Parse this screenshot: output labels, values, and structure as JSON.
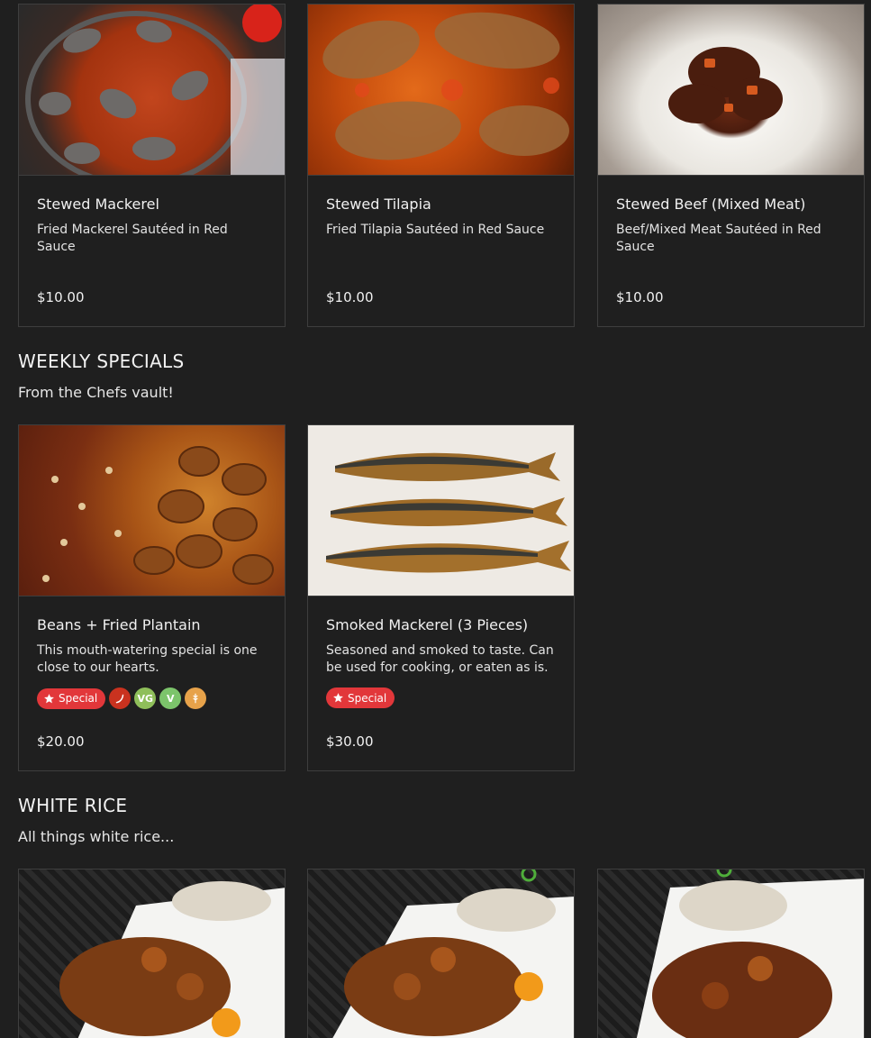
{
  "sections": {
    "stews": {
      "items": [
        {
          "title": "Stewed Mackerel",
          "description": "Fried Mackerel Sautéed in Red Sauce",
          "price": "$10.00"
        },
        {
          "title": "Stewed Tilapia",
          "description": "Fried Tilapia Sautéed in Red Sauce",
          "price": "$10.00"
        },
        {
          "title": "Stewed Beef (Mixed Meat)",
          "description": "Beef/Mixed Meat Sautéed in Red Sauce",
          "price": "$10.00"
        }
      ]
    },
    "weekly_specials": {
      "title": "WEEKLY SPECIALS",
      "description": "From the Chefs vault!",
      "items": [
        {
          "title": "Beans + Fried Plantain",
          "description": "This mouth-watering special is one close to our hearts.",
          "badge": "Special",
          "price": "$20.00",
          "tags": [
            {
              "icon": "chili-icon",
              "color": "#c9321f"
            },
            {
              "icon": "vegan-icon",
              "label": "VG",
              "color": "#8fbf5a"
            },
            {
              "icon": "vegetarian-icon",
              "label": "V",
              "color": "#7cc46b"
            },
            {
              "icon": "gluten-free-icon",
              "color": "#e7a24a"
            }
          ]
        },
        {
          "title": "Smoked Mackerel (3 Pieces)",
          "description": "Seasoned and smoked to taste. Can be used for cooking, or eaten as is.",
          "badge": "Special",
          "price": "$30.00"
        }
      ]
    },
    "white_rice": {
      "title": "WHITE RICE",
      "description": "All things white rice..."
    }
  },
  "colors": {
    "background": "#1f1f1f",
    "card_border": "#3e3e3e",
    "special_badge": "#e2373a"
  }
}
